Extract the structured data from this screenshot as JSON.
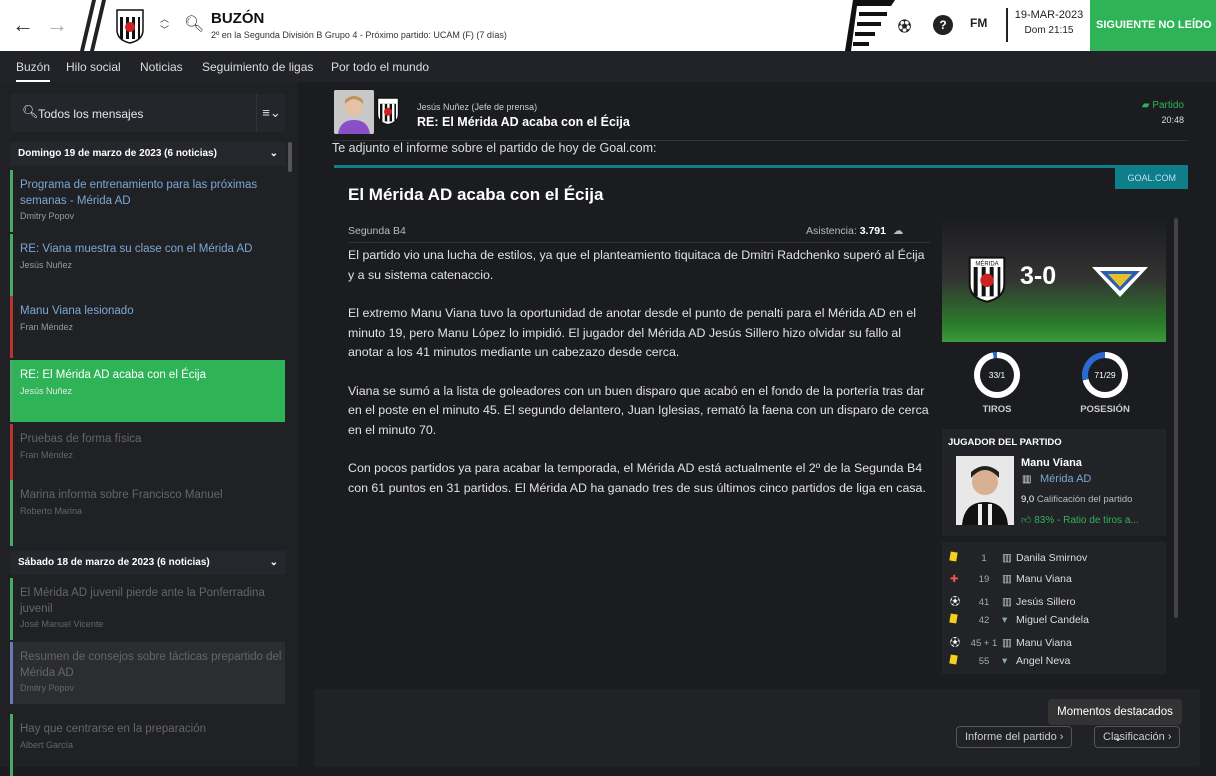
{
  "topbar": {
    "title": "BUZÓN",
    "subtitle": "2º en la Segunda División B Grupo 4 - Próximo partido: UCAM (F) (7 días)",
    "logo_text": "FM",
    "date": "19-MAR-2023",
    "day_time": "Dom 21:15",
    "next_button": "SIGUIENTE NO LEÍDO"
  },
  "tabs": [
    {
      "label": "Buzón"
    },
    {
      "label": "Hilo social"
    },
    {
      "label": "Noticias"
    },
    {
      "label": "Seguimiento de ligas"
    },
    {
      "label": "Por todo el mundo"
    }
  ],
  "sidebar": {
    "filter_label": "Todos los mensajes",
    "groups": [
      {
        "label": "Domingo 19 de marzo de 2023 (6 noticias)"
      },
      {
        "label": "Sábado 18 de marzo de 2023 (6 noticias)"
      }
    ],
    "messages": [
      {
        "subject": "Programa de entrenamiento para las próximas semanas - Mérida AD",
        "from": "Dmitry Popov"
      },
      {
        "subject": "RE: Viana muestra su clase con el Mérida AD",
        "from": "Jesús Nuñez"
      },
      {
        "subject": "Manu Viana lesionado",
        "from": "Fran Méndez"
      },
      {
        "subject": "RE: El Mérida AD acaba con el Écija",
        "from": "Jesús Nuñez"
      },
      {
        "subject": "Pruebas de forma física",
        "from": "Fran Méndez"
      },
      {
        "subject": "Marina informa sobre Francisco Manuel",
        "from": "Roberto Marina"
      },
      {
        "subject": "El Mérida AD juvenil pierde ante la Ponferradina juvenil",
        "from": "José Manuel Vicente"
      },
      {
        "subject": "Resumen de consejos sobre tácticas prepartido del Mérida AD",
        "from": "Dmitry Popov"
      },
      {
        "subject": "Hay que centrarse en la preparación",
        "from": "Albert García"
      }
    ]
  },
  "message": {
    "from": "Jesús Nuñez  (Jefe de prensa)",
    "subject": "RE: El Mérida AD acaba con el Écija",
    "tag": "Partido",
    "time": "20:48",
    "intro": "Te adjunto el informe sobre el partido de hoy de Goal.com:"
  },
  "article": {
    "source": "GOAL.COM",
    "title": "El Mérida AD acaba con el Écija",
    "league": "Segunda B4",
    "attendance_label": "Asistencia:",
    "attendance": "3.791",
    "paragraphs": [
      "El partido vio una lucha de estilos, ya que el planteamiento tiquitaca de Dmitri Radchenko superó al Écija y a su sistema catenaccio.",
      "El extremo Manu Viana tuvo la oportunidad de anotar desde el punto de penalti para el Mérida AD en el minuto 19, pero Manu López lo impidió. El jugador del Mérida AD Jesús Sillero hizo olvidar su fallo al anotar a los 41 minutos mediante un cabezazo desde cerca.",
      "Viana se sumó a la lista de goleadores con un buen disparo que acabó en el fondo de la portería tras dar en el poste en el minuto 45. El segundo delantero, Juan Iglesias, remató la faena con un disparo de cerca en el minuto 70.",
      "Con pocos partidos ya para acabar la temporada, el Mérida AD está actualmente el 2º de la Segunda B4 con 61 puntos en 31 partidos. El Mérida AD ha ganado tres de sus últimos cinco partidos de liga en casa."
    ]
  },
  "match": {
    "score": "3-0",
    "home_badge": "MÉRIDA",
    "shots": "33/1",
    "shots_label": "TIROS",
    "shots_home_fraction": 0.97,
    "possession": "71/29",
    "possession_label": "POSESIÓN",
    "possession_home_fraction": 0.71,
    "motm_header": "JUGADOR DEL PARTIDO",
    "motm_name": "Manu Viana",
    "motm_club": "Mérida AD",
    "motm_rating": "9,0",
    "motm_rating_label": "Calificación del partido",
    "motm_shots": "83% - Ratio de tiros a...",
    "events": [
      {
        "icon": "yellow-card",
        "minute": "1",
        "player": "Danila Smirnov"
      },
      {
        "icon": "injury",
        "minute": "19",
        "player": "Manu Viana"
      },
      {
        "icon": "goal",
        "minute": "41",
        "player": "Jesús Sillero"
      },
      {
        "icon": "yellow-card",
        "minute": "42",
        "player": "Miguel Candela"
      },
      {
        "icon": "goal",
        "minute": "45 + 1",
        "player": "Manu Viana"
      },
      {
        "icon": "yellow-card",
        "minute": "55",
        "player": "Angel Neva"
      }
    ]
  },
  "footer": {
    "highlights": "Momentos destacados",
    "report": "Informe del partido",
    "table": "Clasificación"
  },
  "colors": {
    "accent": "#2eb457",
    "goal_teal": "#0d7f8a",
    "link": "#7aa8d6"
  }
}
